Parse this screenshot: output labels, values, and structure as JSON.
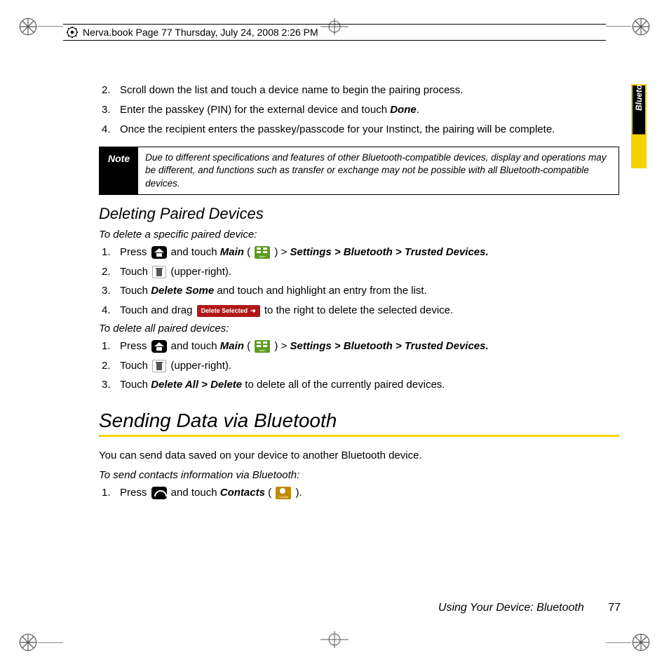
{
  "book_header": "Nerva.book  Page 77  Thursday, July 24, 2008  2:26 PM",
  "side_tab": "Bluetooth",
  "steps_top": [
    {
      "n": "2.",
      "pre": "Scroll down the list and touch a device name to begin the pairing process."
    },
    {
      "n": "3.",
      "pre": "Enter the passkey (PIN) for the external device and touch ",
      "bold": "Done",
      "post": "."
    },
    {
      "n": "4.",
      "pre": "Once the recipient enters the passkey/passcode for your Instinct, the pairing will be complete."
    }
  ],
  "note": {
    "label": "Note",
    "text": "Due to different specifications and features of other Bluetooth-compatible devices, display and operations may be different, and functions such as transfer or exchange may not be possible with all Bluetooth-compatible devices."
  },
  "heading_delete": "Deleting Paired Devices",
  "lead_specific": "To delete a specific paired device:",
  "del_specific": {
    "s1_pre": "Press ",
    "s1_mid1": " and touch ",
    "s1_main": "Main",
    "s1_paren_open": " ( ",
    "s1_paren_close": " ) > ",
    "s1_path": "Settings > Bluetooth > Trusted Devices.",
    "s2_pre": "Touch ",
    "s2_post": " (upper-right).",
    "s3_pre": "Touch ",
    "s3_bold": "Delete Some",
    "s3_post": " and touch and highlight an entry from the list.",
    "s4_pre": "Touch and drag ",
    "s4_chip": "Delete Selected",
    "s4_post": " to the right to delete the selected device."
  },
  "lead_all": "To delete all paired devices:",
  "del_all": {
    "s1_pre": "Press ",
    "s1_mid1": " and touch ",
    "s1_main": "Main",
    "s1_paren_open": " ( ",
    "s1_paren_close": " ) > ",
    "s1_path": "Settings > Bluetooth > Trusted Devices.",
    "s2_pre": "Touch ",
    "s2_post": " (upper-right).",
    "s3_pre": "Touch ",
    "s3_bold": "Delete All > Delete",
    "s3_post": " to delete all of the currently paired devices."
  },
  "heading_send": "Sending Data via Bluetooth",
  "send_intro": "You can send data saved on your device to another Bluetooth device.",
  "lead_send": "To send contacts information via Bluetooth:",
  "send": {
    "s1_pre": "Press ",
    "s1_mid1": " and touch ",
    "s1_bold": "Contacts",
    "s1_paren_open": " ( ",
    "s1_paren_close": " )."
  },
  "footer": {
    "title": "Using Your Device: Bluetooth",
    "page": "77"
  }
}
